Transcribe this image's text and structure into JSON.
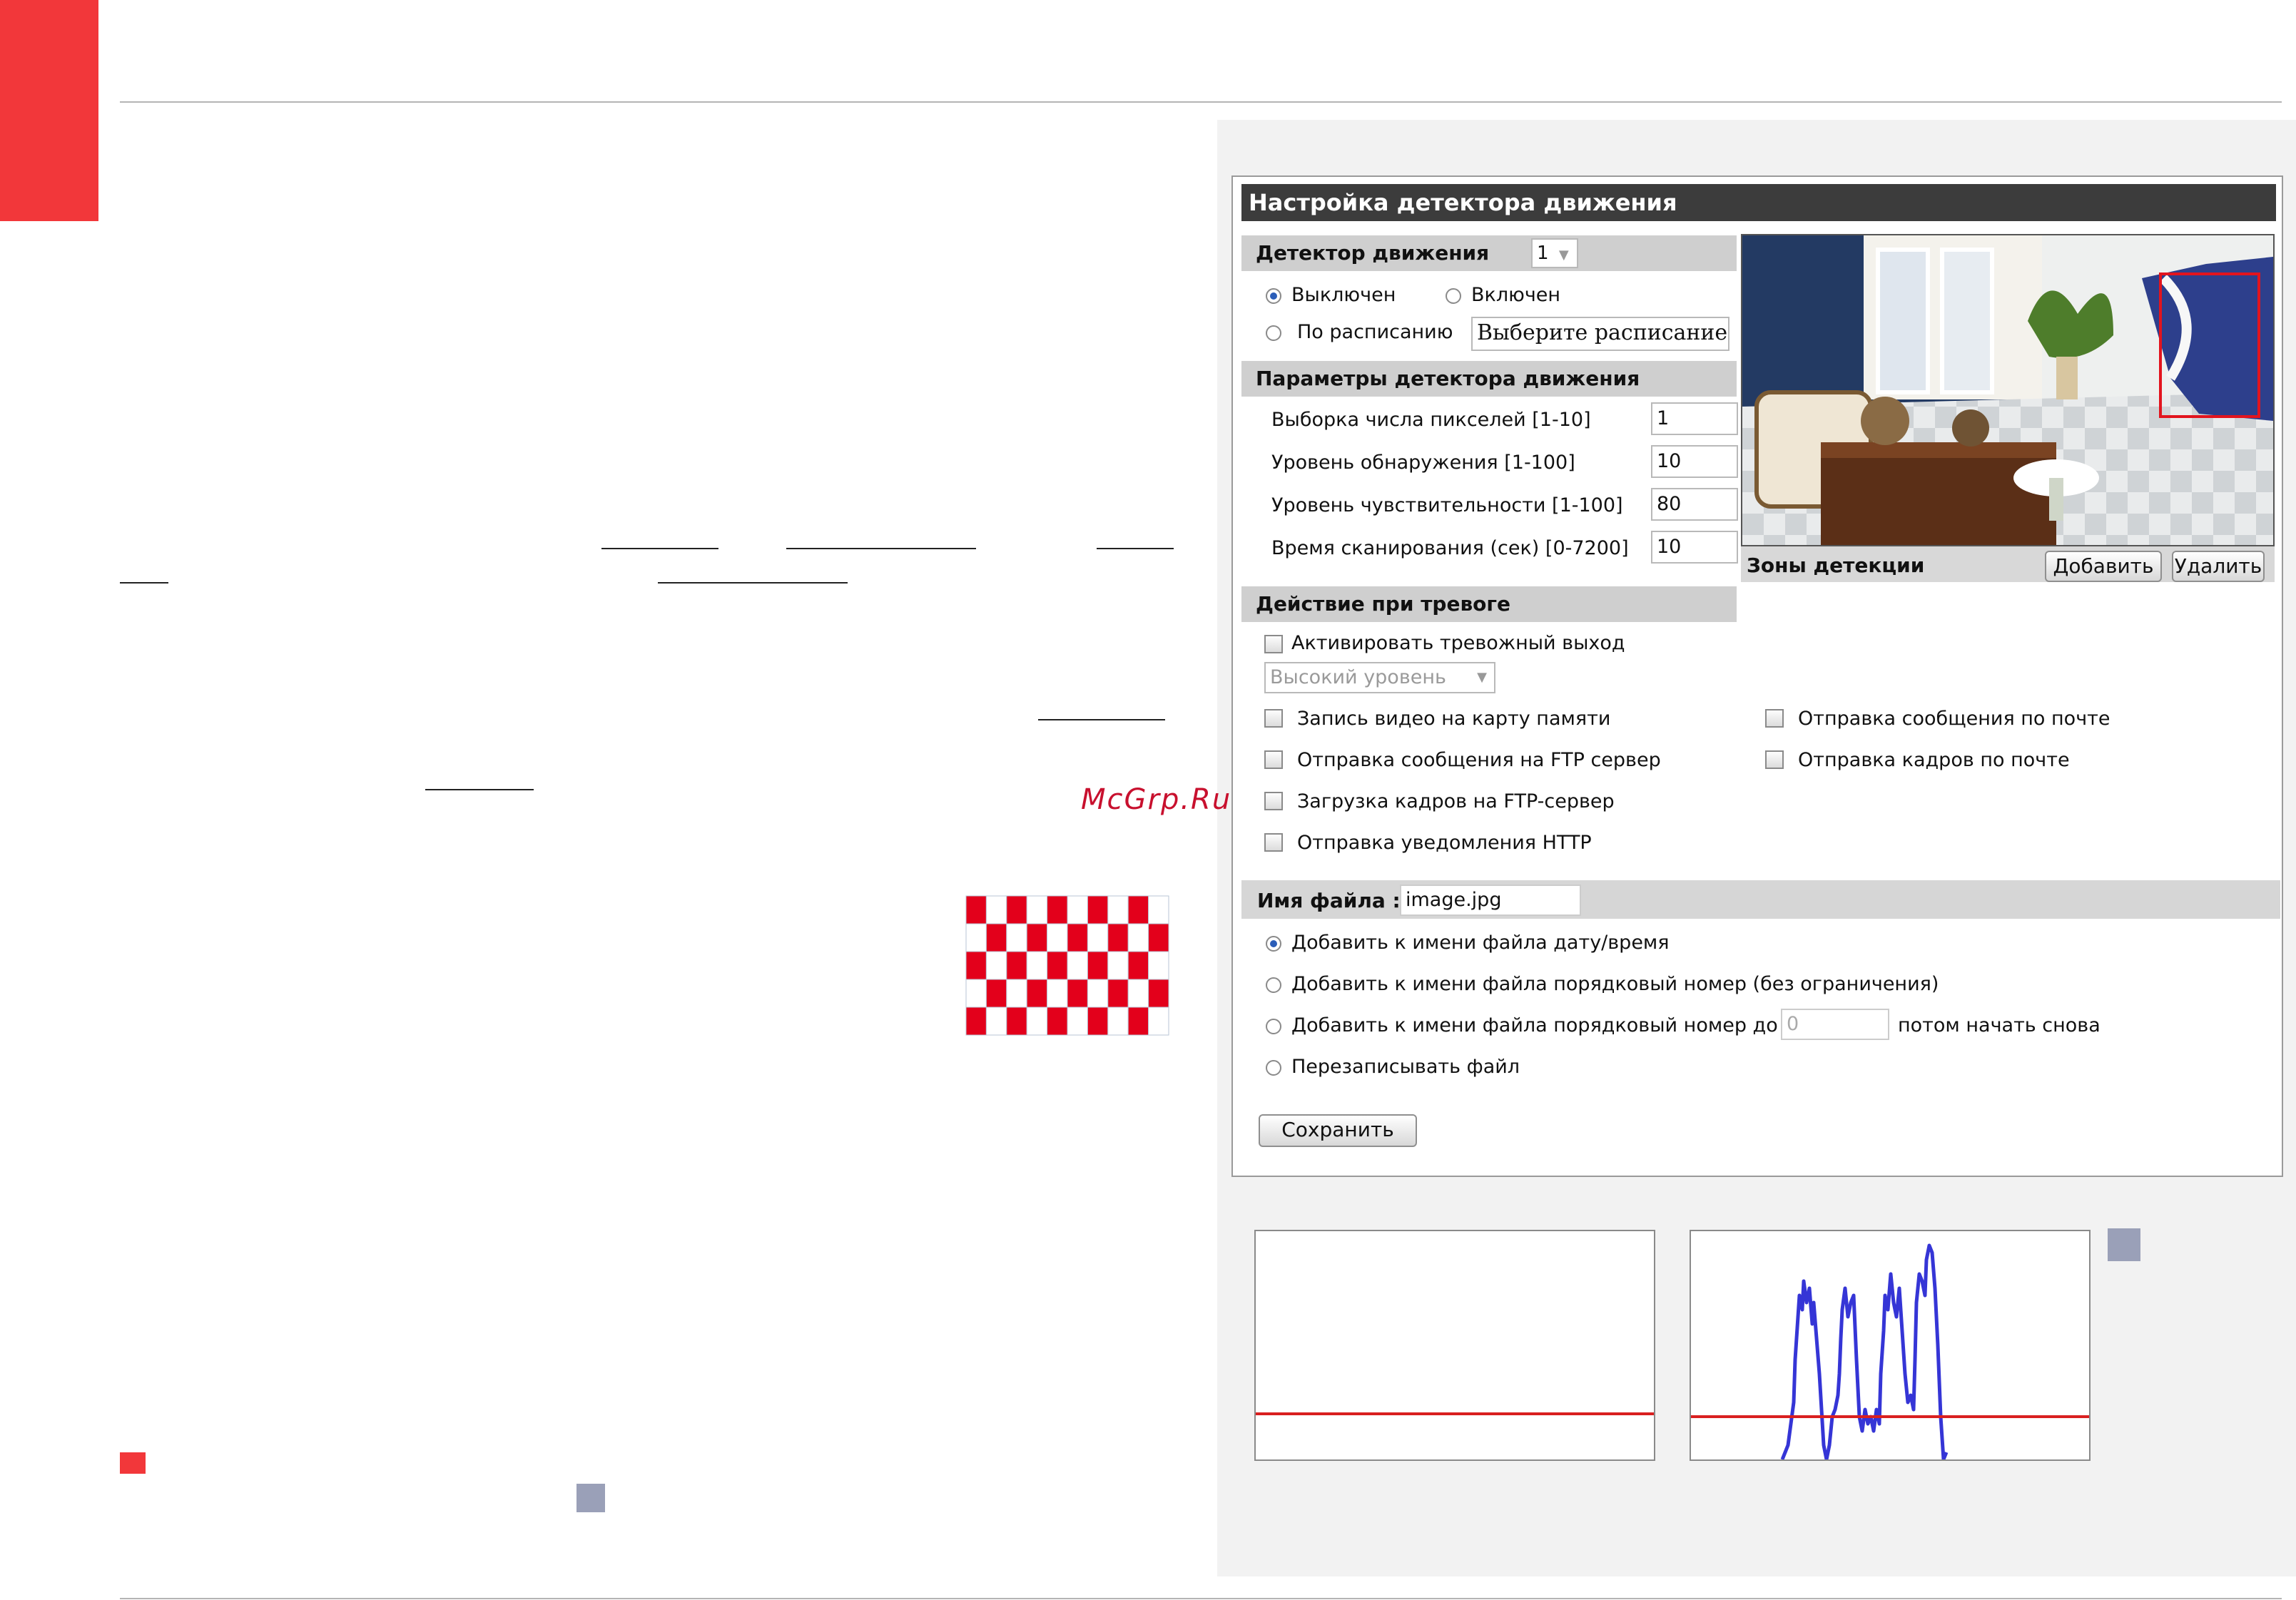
{
  "watermark": "McGrp.Ru",
  "panel": {
    "title": "Настройка детектора движения",
    "detector": {
      "label": "Детектор движения",
      "select_value": "1",
      "off_label": "Выключен",
      "on_label": "Включен",
      "schedule_label": "По расписанию",
      "schedule_placeholder": "Выберите расписание...",
      "state": "off"
    },
    "params": {
      "label": "Параметры детектора движения",
      "rows": [
        {
          "label": "Выборка числа пикселей [1-10]",
          "value": "1"
        },
        {
          "label": "Уровень обнаружения [1-100]",
          "value": "10"
        },
        {
          "label": "Уровень чувствительности [1-100]",
          "value": "80"
        },
        {
          "label": "Время сканирования (сек) [0-7200]",
          "value": "10"
        }
      ]
    },
    "zones": {
      "label": "Зоны детекции",
      "add_button": "Добавить",
      "delete_button": "Удалить"
    },
    "alarm": {
      "label": "Действие при тревоге",
      "activate_output": "Активировать тревожный выход",
      "level_select": "Высокий уровень",
      "left_options": [
        "Запись видео на карту памяти",
        "Отправка сообщения на FTP сервер",
        "Загрузка кадров на FTP-сервер",
        "Отправка уведомления HTTP"
      ],
      "right_options": [
        "Отправка сообщения по почте",
        "Отправка кадров по почте"
      ]
    },
    "filename": {
      "label": "Имя файла :",
      "value": "image.jpg",
      "options": [
        {
          "label": "Добавить к имени файла дату/время",
          "selected": true
        },
        {
          "label": "Добавить к имени файла порядковый номер (без ограничения)",
          "selected": false
        },
        {
          "label": "Добавить к имени файла порядковый номер до",
          "selected": false
        },
        {
          "label": "Перезаписывать файл",
          "selected": false
        }
      ],
      "counter_value": "0",
      "counter_suffix": "потом начать снова"
    },
    "save_button": "Сохранить"
  },
  "checkerboard": {
    "rows": 5,
    "cols": 10,
    "color": "#e3001b"
  },
  "colors": {
    "accent_red": "#f2373a",
    "graph_line": "#3535d6",
    "threshold_line": "#d92020"
  }
}
